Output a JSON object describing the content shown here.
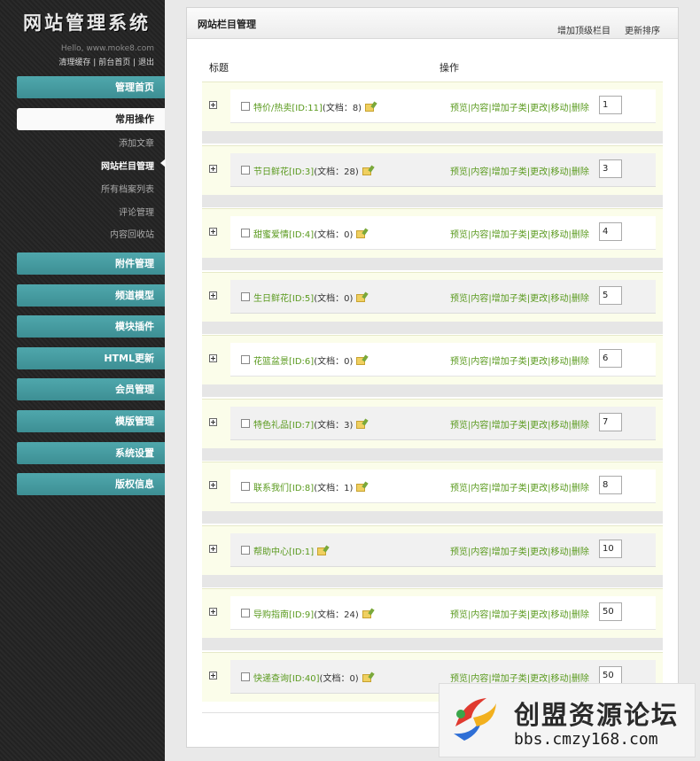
{
  "sidebar": {
    "logo": "网站管理系统",
    "hello": "Hello, www.moke8.com",
    "links": [
      "清理缓存",
      "前台首页",
      "退出"
    ],
    "home": "管理首页",
    "active_section": "常用操作",
    "sub_items": [
      "添加文章",
      "网站栏目管理",
      "所有档案列表",
      "评论管理",
      "内容回收站"
    ],
    "current_sub": "网站栏目管理",
    "menu": [
      "附件管理",
      "频道模型",
      "模块插件",
      "HTML更新",
      "会员管理",
      "模版管理",
      "系统设置",
      "版权信息"
    ]
  },
  "panel": {
    "title": "网站栏目管理",
    "add_top": "增加顶级栏目",
    "update_order": "更新排序",
    "col_title": "标题",
    "col_ops": "操作"
  },
  "ops_labels": [
    "预览",
    "内容",
    "增加子类",
    "更改",
    "移动",
    "删除"
  ],
  "rows": [
    {
      "name": "特价/热卖[ID:11]",
      "count": "(文档：8)",
      "order": "1"
    },
    {
      "name": "节日鲜花[ID:3]",
      "count": "(文档：28)",
      "order": "3"
    },
    {
      "name": "甜蜜爱情[ID:4]",
      "count": "(文档：0)",
      "order": "4"
    },
    {
      "name": "生日鲜花[ID:5]",
      "count": "(文档：0)",
      "order": "5"
    },
    {
      "name": "花篮盆景[ID:6]",
      "count": "(文档：0)",
      "order": "6"
    },
    {
      "name": "特色礼品[ID:7]",
      "count": "(文档：3)",
      "order": "7"
    },
    {
      "name": "联系我们[ID:8]",
      "count": "(文档：1)",
      "order": "8"
    },
    {
      "name": "帮助中心[ID:1]",
      "count": "",
      "order": "10"
    },
    {
      "name": "导购指南[ID:9]",
      "count": "(文档：24)",
      "order": "50"
    },
    {
      "name": "快递查询[ID:40]",
      "count": "(文档：0)",
      "order": "50"
    }
  ],
  "watermark": {
    "title": "创盟资源论坛",
    "url": "bbs.cmzy168.com"
  }
}
